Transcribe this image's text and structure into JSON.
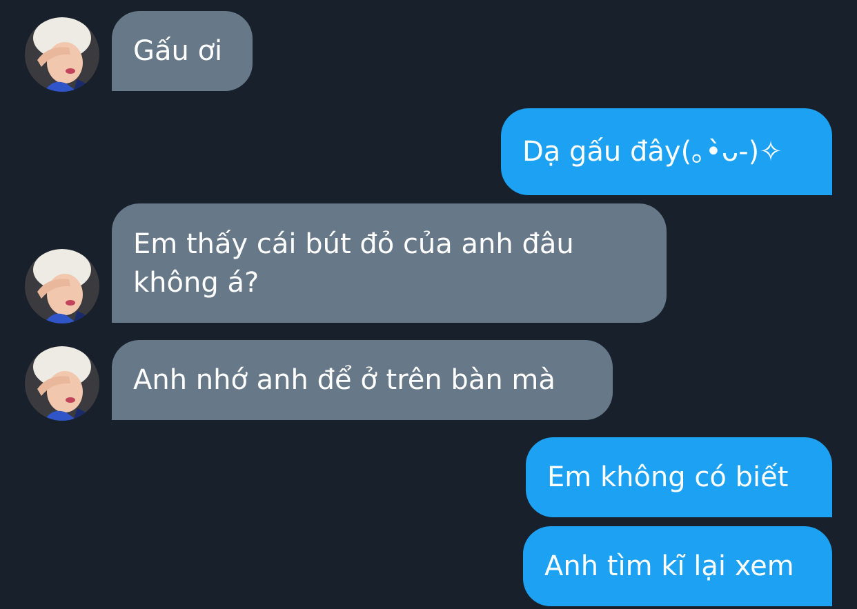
{
  "colors": {
    "background": "#17202b",
    "incoming_bubble": "#677888",
    "outgoing_bubble": "#1da1f2",
    "text": "#ffffff"
  },
  "messages": [
    {
      "direction": "incoming",
      "text": "Gấu ơi",
      "has_avatar": true
    },
    {
      "direction": "outgoing",
      "text": "Dạ gấu đây(｡•̀ᴗ-)✧"
    },
    {
      "direction": "incoming",
      "text": "Em thấy cái bút đỏ của anh đâu không á?",
      "has_avatar": true
    },
    {
      "direction": "incoming",
      "text": "Anh nhớ anh để ở trên bàn mà",
      "has_avatar": true
    },
    {
      "direction": "outgoing",
      "text": "Em không có biết"
    },
    {
      "direction": "outgoing",
      "text": "Anh tìm kĩ lại xem"
    }
  ]
}
